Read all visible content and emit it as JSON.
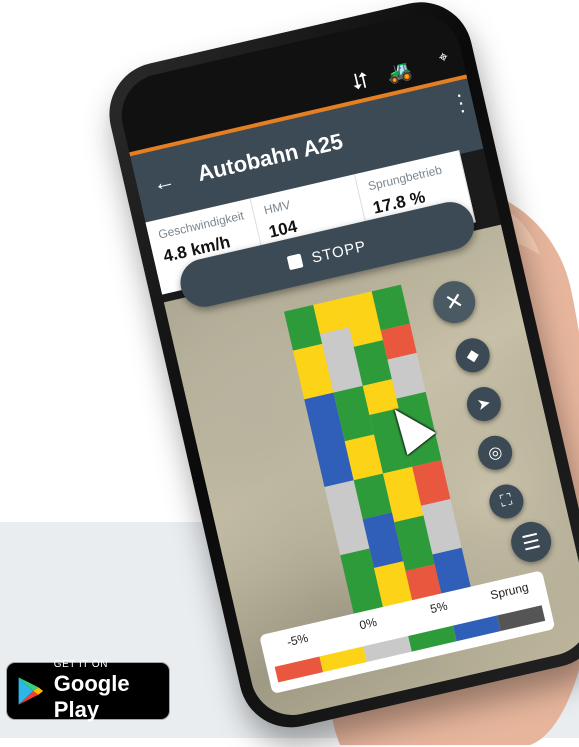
{
  "app": {
    "title": "Autobahn A25"
  },
  "stats": [
    {
      "label": "Geschwindigkeit",
      "value": "4.8 km/h"
    },
    {
      "label": "HMV",
      "value": "104"
    },
    {
      "label": "Sprungbetrieb",
      "value": "17.8 %"
    }
  ],
  "stop_button": {
    "label": "STOPP"
  },
  "legend": {
    "labels": [
      "-5%",
      "0%",
      "5%",
      "Sprung"
    ],
    "colors": [
      "#e9573f",
      "#fcd317",
      "#c9c9c9",
      "#2e9b3a",
      "#2f5fb8",
      "#555555"
    ]
  },
  "colors": {
    "appbar": "#3b4a55",
    "accent": "#e67e22",
    "yellow": "#fcd317",
    "green": "#2e9b3a",
    "blue": "#2f5fb8",
    "red": "#e9573f",
    "gray": "#c9c9c9"
  },
  "store_badge": {
    "top": "GET IT ON",
    "main": "Google Play"
  }
}
